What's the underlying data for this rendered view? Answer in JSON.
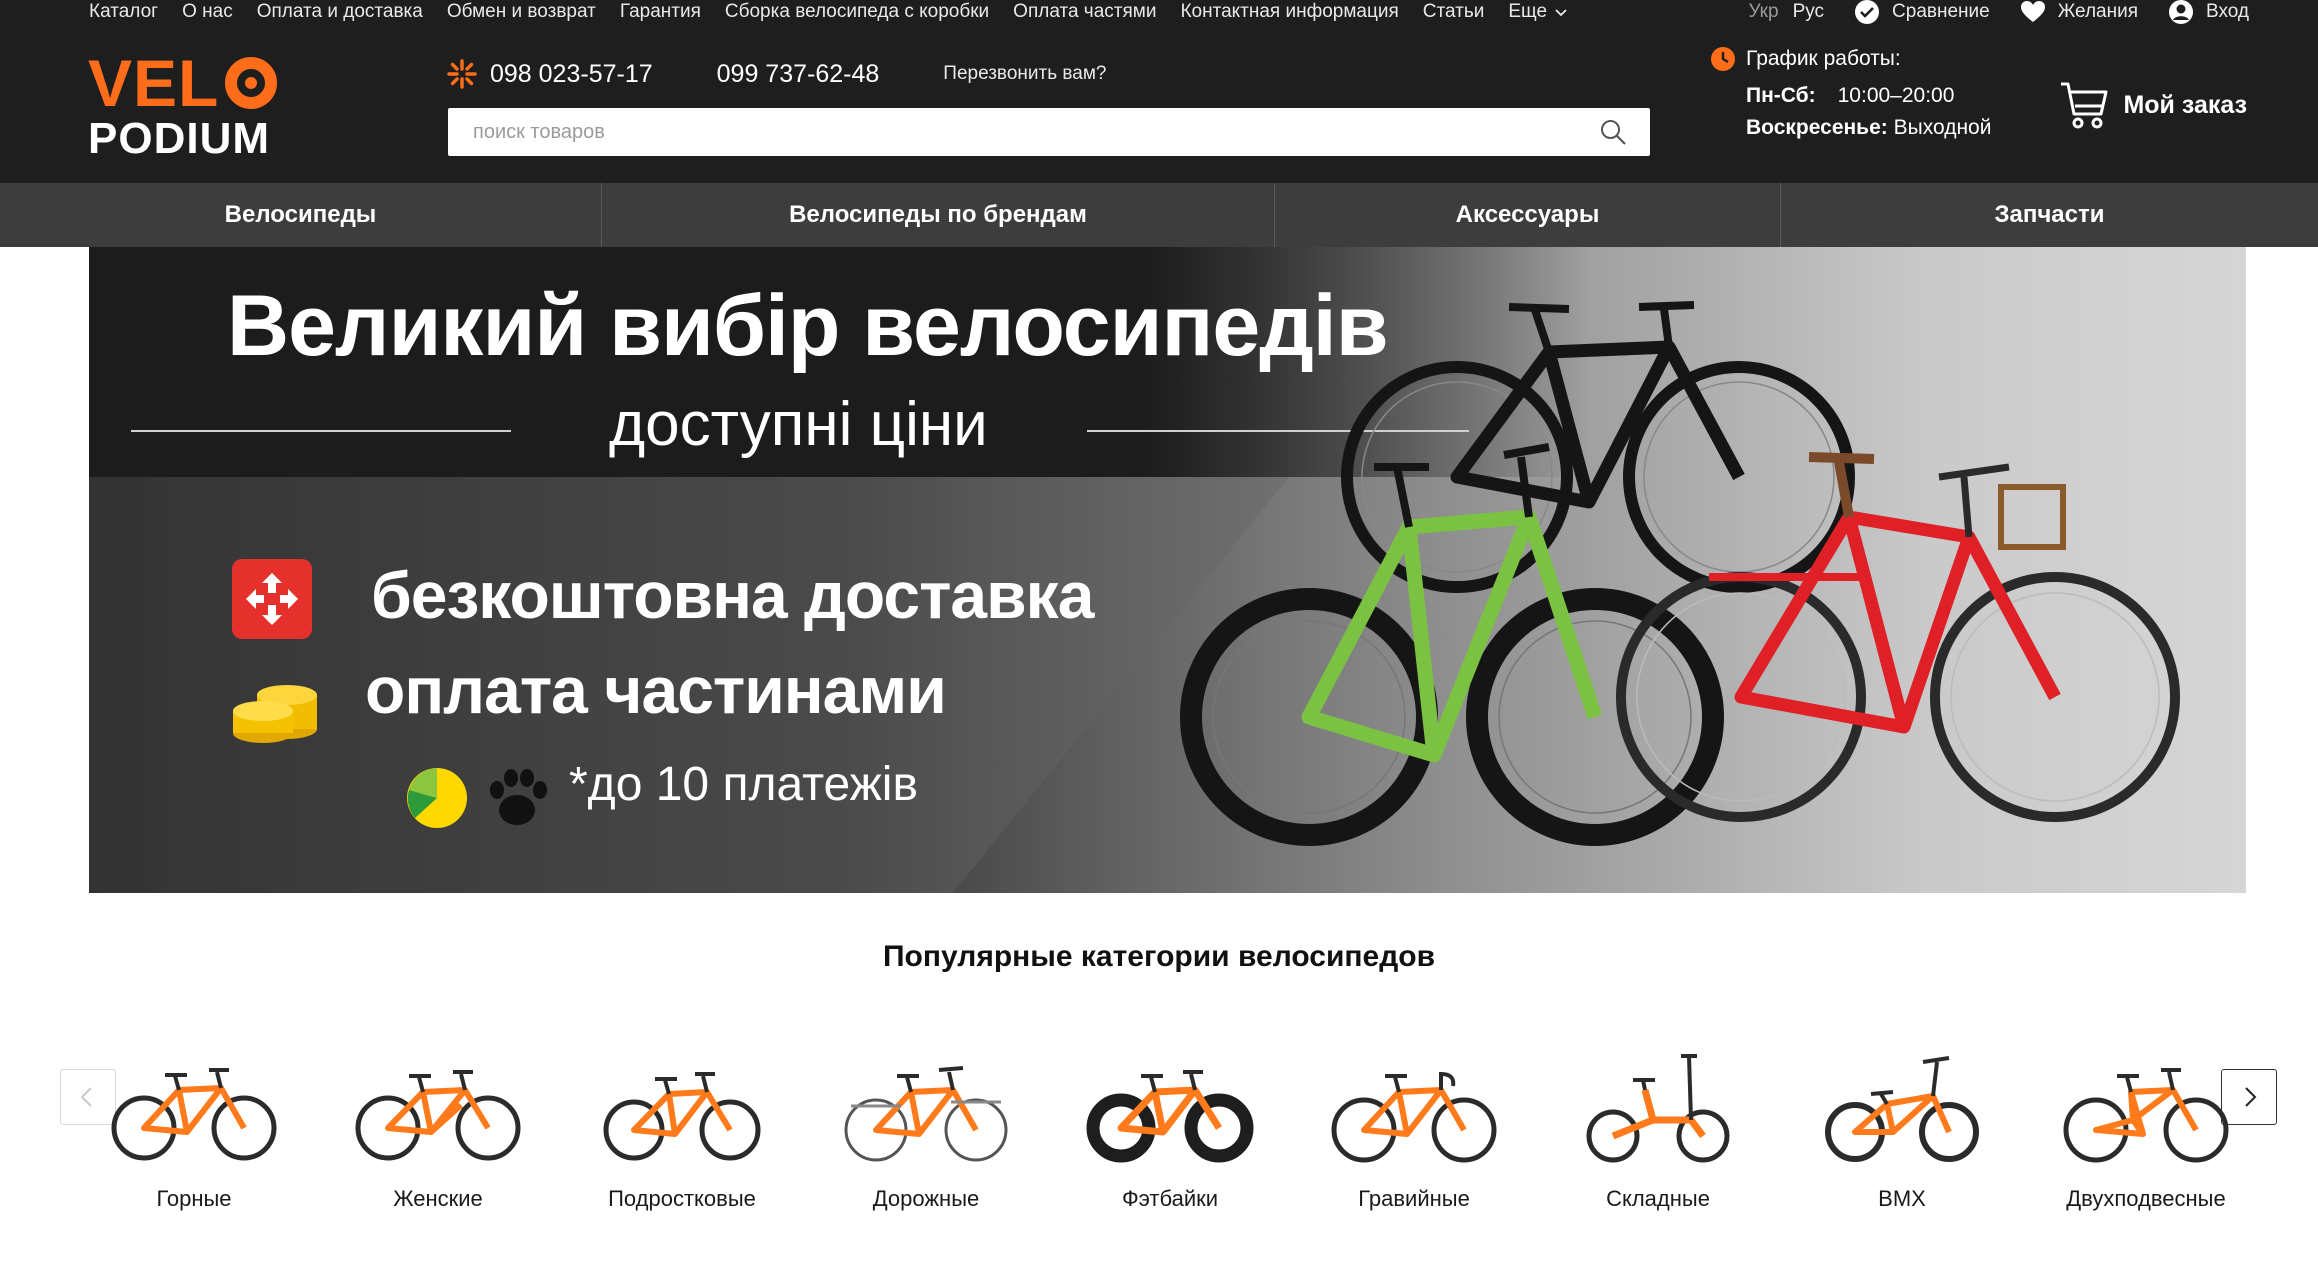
{
  "topnav": {
    "items": [
      "Каталог",
      "О нас",
      "Оплата и доставка",
      "Обмен и возврат",
      "Гарантия",
      "Сборка велосипеда с коробки",
      "Оплата частями",
      "Контактная информация",
      "Статьи"
    ],
    "more": "Еще"
  },
  "topright": {
    "lang_ukr": "Укр",
    "lang_rus": "Рус",
    "compare": "Сравнение",
    "wishlist": "Желания",
    "login": "Вход"
  },
  "logo": {
    "line1_a": "VEL",
    "line2": "PODIUM"
  },
  "contacts": {
    "phone1": "098 023-57-17",
    "phone2": "099 737-62-48",
    "callback": "Перезвонить вам?"
  },
  "search": {
    "placeholder": "поиск товаров"
  },
  "schedule": {
    "title": "График работы:",
    "weekdays_label": "Пн-Сб:",
    "weekdays_value": "10:00–20:00",
    "sunday_label": "Воскресенье:",
    "sunday_value": "Выходной"
  },
  "cart": {
    "label": "Мой заказ"
  },
  "mainnav": [
    "Велосипеды",
    "Велосипеды по брендам",
    "Аксессуары",
    "Запчасти"
  ],
  "banner": {
    "headline": "Великий вибір велосипедів",
    "subtitle": "доступні ціни",
    "delivery": "безкоштовна доставка",
    "installments": "оплата частинами",
    "payments_note": "*до 10 платежів"
  },
  "popular": {
    "title": "Популярные категории велосипедов",
    "categories": [
      "Горные",
      "Женские",
      "Подростковые",
      "Дорожные",
      "Фэтбайки",
      "Гравийные",
      "Складные",
      "BMX",
      "Двухподвесные"
    ]
  },
  "colors": {
    "header_bg": "#1e1e1e",
    "nav_bg": "#3d3d3d",
    "accent": "#ff6d1a",
    "frame_orange": "#ff7a1a"
  }
}
